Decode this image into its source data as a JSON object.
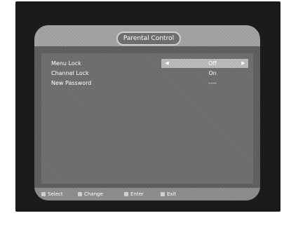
{
  "menu": {
    "title": "Parental Control",
    "rows": [
      {
        "label": "Menu Lock",
        "value": "Off",
        "selected": true
      },
      {
        "label": "Channel Lock",
        "value": "On",
        "selected": false
      },
      {
        "label": "New Password",
        "value": "----",
        "selected": false
      }
    ],
    "arrows": {
      "left": "◀",
      "right": "▶"
    }
  },
  "footer": {
    "hints": [
      {
        "label": "Select"
      },
      {
        "label": "Change"
      },
      {
        "label": "Enter"
      },
      {
        "label": "Exit"
      }
    ]
  },
  "colors": {
    "background": "#1b1b1b",
    "panel": "#5c5c5c",
    "header": "#a5a5a5",
    "highlight": "#bdbdbd",
    "footer": "#8f8f8f",
    "text": "#ffffff"
  }
}
